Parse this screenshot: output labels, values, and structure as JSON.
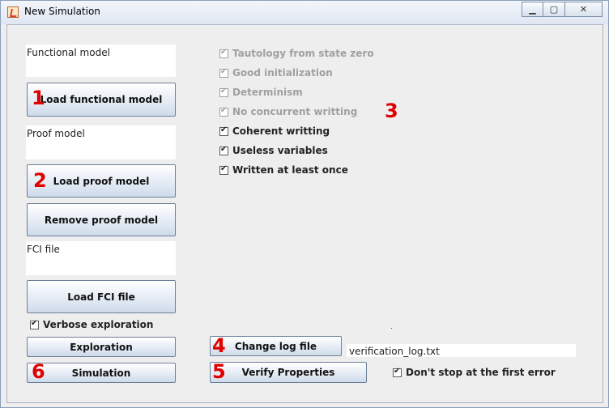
{
  "window": {
    "title": "New Simulation"
  },
  "left": {
    "functional_model_label": "Functional model",
    "load_functional_label": "Load functional model",
    "proof_model_label": "Proof model",
    "load_proof_label": "Load proof model",
    "remove_proof_label": "Remove proof model",
    "fci_file_label": "FCI file",
    "load_fci_label": "Load FCI file",
    "verbose_label": "Verbose exploration",
    "exploration_label": "Exploration",
    "simulation_label": "Simulation"
  },
  "properties": [
    {
      "label": "Tautology from state zero",
      "checked": true,
      "enabled": false
    },
    {
      "label": "Good initialization",
      "checked": true,
      "enabled": false
    },
    {
      "label": "Determinism",
      "checked": true,
      "enabled": false
    },
    {
      "label": "No concurrent writting",
      "checked": true,
      "enabled": false
    },
    {
      "label": "Coherent writting",
      "checked": true,
      "enabled": true
    },
    {
      "label": "Useless variables",
      "checked": true,
      "enabled": true
    },
    {
      "label": "Written at least once",
      "checked": true,
      "enabled": true
    }
  ],
  "bottom": {
    "change_log_label": "Change log file",
    "log_file_value": "verification_log.txt",
    "verify_label": "Verify Properties",
    "dont_stop_label": "Don't stop at the first error"
  },
  "annotations": [
    "1",
    "2",
    "3",
    "4",
    "5",
    "6"
  ],
  "icons": {
    "app": "java-cup-icon",
    "minimize": "minimize-icon",
    "maximize": "maximize-icon",
    "close": "close-icon"
  },
  "colors": {
    "annotation": "#e00000",
    "disabled_text": "#a0a0a0"
  }
}
